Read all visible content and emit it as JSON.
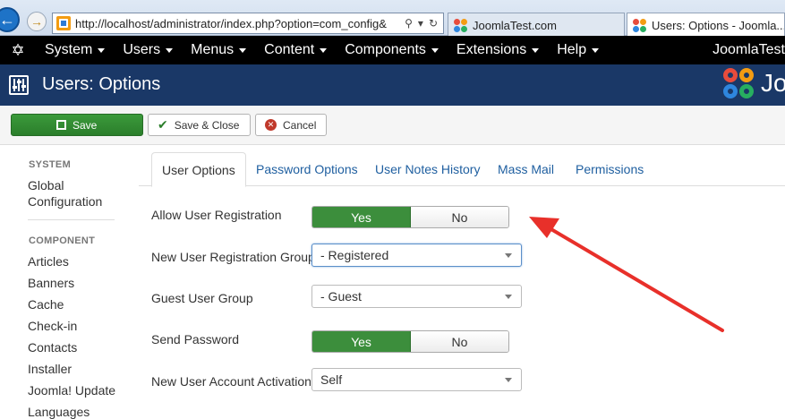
{
  "browser": {
    "address": "http://localhost/administrator/index.php?option=com_config&",
    "tabs": [
      {
        "label": "JoomlaTest.com"
      },
      {
        "label": "Users: Options - Joomla..."
      }
    ]
  },
  "topmenu": {
    "items": [
      "System",
      "Users",
      "Menus",
      "Content",
      "Components",
      "Extensions",
      "Help"
    ],
    "site_name": "JoomlaTest"
  },
  "header": {
    "title": "Users: Options",
    "brand_text": "Jo"
  },
  "toolbar": {
    "save_label": "Save",
    "save_close_label": "Save & Close",
    "cancel_label": "Cancel"
  },
  "sidebar": {
    "system_heading": "SYSTEM",
    "global_config_line1": "Global",
    "global_config_line2": "Configuration",
    "component_heading": "COMPONENT",
    "components": [
      "Articles",
      "Banners",
      "Cache",
      "Check-in",
      "Contacts",
      "Installer",
      "Joomla! Update",
      "Languages"
    ]
  },
  "tabs": [
    "User Options",
    "Password Options",
    "User Notes History",
    "Mass Mail",
    "Permissions"
  ],
  "form": {
    "allow_registration_label": "Allow User Registration",
    "new_user_group_label": "New User Registration Group",
    "new_user_group_value": "- Registered",
    "guest_group_label": "Guest User Group",
    "guest_group_value": "- Guest",
    "send_password_label": "Send Password",
    "account_activation_label": "New User Account Activation",
    "account_activation_value": "Self",
    "yes_label": "Yes",
    "no_label": "No"
  },
  "colors": {
    "header_bg": "#1a3867",
    "save_green": "#2b7e2b",
    "toggle_yes": "#3c8e3c",
    "link_blue": "#1f5fa0",
    "annotation_red": "#e8302a"
  }
}
